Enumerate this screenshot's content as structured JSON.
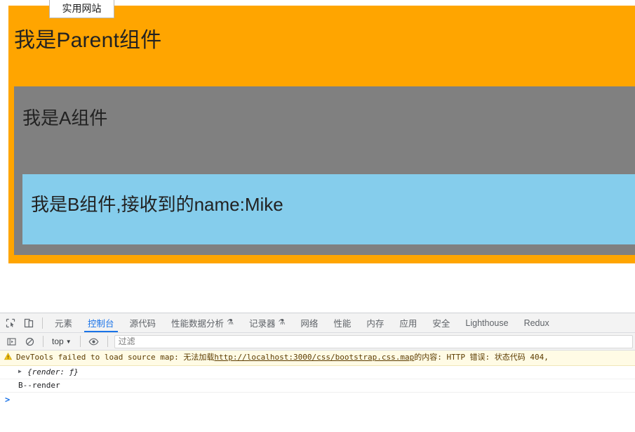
{
  "page": {
    "bookmark_chip": {
      "label": "实用网站",
      "icon": "bookmark-chip"
    },
    "parent_component": {
      "title": "我是Parent组件",
      "bg_color": "#ffa500"
    },
    "a_component": {
      "title": "我是A组件",
      "bg_color": "#808080"
    },
    "b_component": {
      "title": "我是B组件,接收到的name:Mike",
      "bg_color": "#85cdec",
      "prop_name": "name",
      "prop_value": "Mike"
    }
  },
  "devtools": {
    "left_icons": [
      {
        "name": "inspect-element-icon",
        "title": "检查元素"
      },
      {
        "name": "device-toolbar-icon",
        "title": "切换设备工具栏"
      }
    ],
    "tabs": [
      {
        "label": "元素",
        "active": false,
        "flask": false
      },
      {
        "label": "控制台",
        "active": true,
        "flask": false
      },
      {
        "label": "源代码",
        "active": false,
        "flask": false
      },
      {
        "label": "性能数据分析",
        "active": false,
        "flask": true
      },
      {
        "label": "记录器",
        "active": false,
        "flask": true
      },
      {
        "label": "网络",
        "active": false,
        "flask": false
      },
      {
        "label": "性能",
        "active": false,
        "flask": false
      },
      {
        "label": "内存",
        "active": false,
        "flask": false
      },
      {
        "label": "应用",
        "active": false,
        "flask": false
      },
      {
        "label": "安全",
        "active": false,
        "flask": false
      },
      {
        "label": "Lighthouse",
        "active": false,
        "flask": false
      },
      {
        "label": "Redux",
        "active": false,
        "flask": false
      }
    ],
    "flask_glyph": "⚗",
    "console_toolbar": {
      "sidebar_toggle": {
        "name": "console-sidebar-icon"
      },
      "clear_console": {
        "name": "clear-console-icon"
      },
      "context_selector": {
        "label": "top",
        "caret": "▼"
      },
      "eye_icon": {
        "name": "live-expression-eye-icon"
      },
      "filter": {
        "placeholder": "过滤",
        "value": ""
      }
    },
    "messages": [
      {
        "type": "warning",
        "icon": "warning-triangle-icon",
        "text_before_link": "DevTools failed to load source map: 无法加载 ",
        "link": "http://localhost:3000/css/bootstrap.css.map",
        "text_after_link": " 的内容: HTTP 错误: 状态代码 404,"
      },
      {
        "type": "object",
        "disclosure": "▶",
        "text": "{render: ƒ}"
      },
      {
        "type": "log",
        "text": "B--render"
      }
    ],
    "prompt": {
      "caret": ">",
      "value": "",
      "placeholder": ""
    }
  }
}
